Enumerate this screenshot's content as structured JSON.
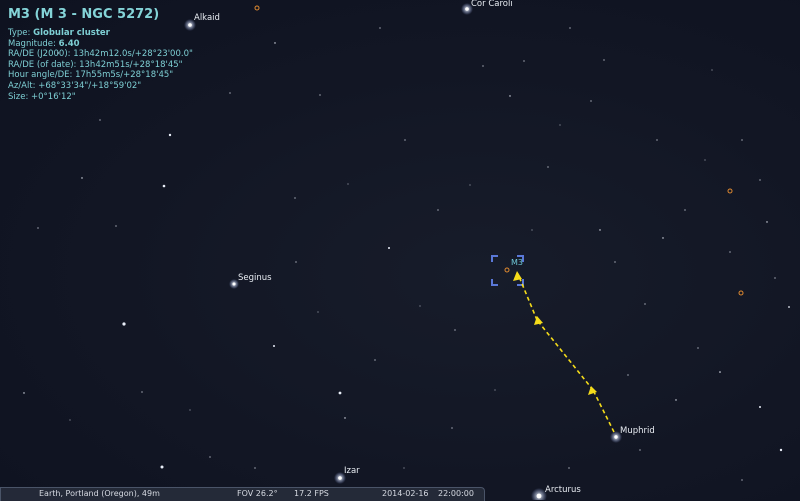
{
  "object_info": {
    "title": "M3 (M 3 - NGC 5272)",
    "type_label": "Type: ",
    "type_value": "Globular cluster",
    "magnitude_label": "Magnitude: ",
    "magnitude_value": "6.40",
    "ra_de_j2000": "RA/DE (J2000): 13h42m12.0s/+28°23'00.0\"",
    "ra_de_date": "RA/DE (of date): 13h42m51s/+28°18'45\"",
    "hour_angle": "Hour angle/DE: 17h55m5s/+28°18'45\"",
    "az_alt": "Az/Alt: +68°33'34\"/+18°59'02\"",
    "size": "Size: +0°16'12\""
  },
  "labels": {
    "alkaid": "Alkaid",
    "cor_caroli": "Cor Caroli",
    "seginus": "Seginus",
    "m3": "M3",
    "muphrid": "Muphrid",
    "izar": "Izar",
    "arcturus": "Arcturus"
  },
  "status_bar": {
    "location": "Earth, Portland (Oregon), 49m",
    "fov": "FOV 26.2°",
    "fps": "17.2 FPS",
    "date": "2014-02-16",
    "time": "22:00:00"
  },
  "colors": {
    "info_text": "#7ecfd4",
    "pointer_arrow": "#f5dc1a",
    "selection_marker": "#5a78d8",
    "deep_sky_object": "#e08a30"
  }
}
